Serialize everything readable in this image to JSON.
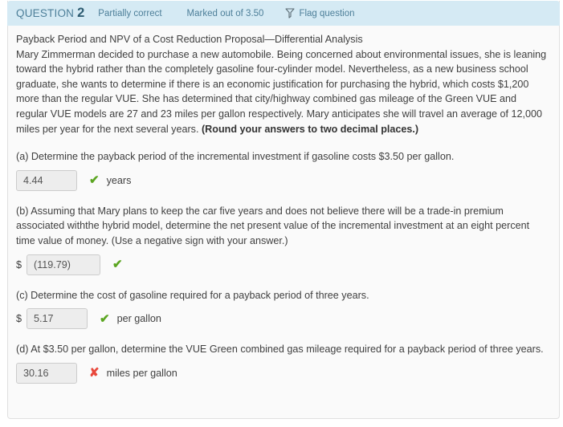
{
  "header": {
    "question_label": "QUESTION",
    "question_number": "2",
    "grade_status": "Partially correct",
    "marks": "Marked out of 3.50",
    "flag_label": "Flag question",
    "background_color": "#d5eaf4",
    "text_color": "#4d7f99"
  },
  "question": {
    "title": "Payback Period and NPV of a Cost Reduction Proposal—Differential Analysis",
    "body_text": "Mary Zimmerman decided to purchase a new automobile. Being concerned about environmental issues, she is leaning toward the hybrid rather than the completely gasoline four-cylinder model. Nevertheless, as a new business school graduate, she wants to determine if there is an economic justification for purchasing the hybrid, which costs $1,200 more than the regular VUE. She has determined that city/highway combined gas mileage of the Green VUE and regular VUE models are 27 and 23 miles per gallon respectively. Mary anticipates she will travel an average of 12,000 miles per year for the next several years. ",
    "body_bold_tail": "(Round your answers to two decimal places.)"
  },
  "parts": [
    {
      "id": "a",
      "prompt": "(a) Determine the payback period of the incremental investment if gasoline costs $3.50 per gallon.",
      "currency_prefix": "",
      "value": "4.44",
      "placeholder": "",
      "mark": "✔",
      "mark_state": "correct",
      "mark_color": "#5ba521",
      "unit": "years",
      "input_width": "narrow"
    },
    {
      "id": "b",
      "prompt": "(b) Assuming that Mary plans to keep the car five years and does not believe there will be a trade-in premium associated withthe hybrid model, determine the net present value of the incremental investment at an eight percent time value of money. (Use a negative sign with your answer.)",
      "currency_prefix": "$",
      "value": "(119.79)",
      "placeholder": "",
      "mark": "✔",
      "mark_state": "correct",
      "mark_color": "#5ba521",
      "unit": "",
      "input_width": "wide"
    },
    {
      "id": "c",
      "prompt": "(c) Determine the cost of gasoline required for a payback period of three years.",
      "currency_prefix": "$",
      "value": "5.17",
      "placeholder": "",
      "mark": "✔",
      "mark_state": "correct",
      "mark_color": "#5ba521",
      "unit": "per gallon",
      "input_width": "narrow"
    },
    {
      "id": "d",
      "prompt": "(d) At $3.50 per gallon, determine the VUE Green combined gas mileage required for a payback period of three years.",
      "currency_prefix": "",
      "value": "30.16",
      "placeholder": "",
      "mark": "✘",
      "mark_state": "incorrect",
      "mark_color": "#e8483c",
      "unit": "miles per gallon",
      "input_width": "narrow"
    }
  ]
}
